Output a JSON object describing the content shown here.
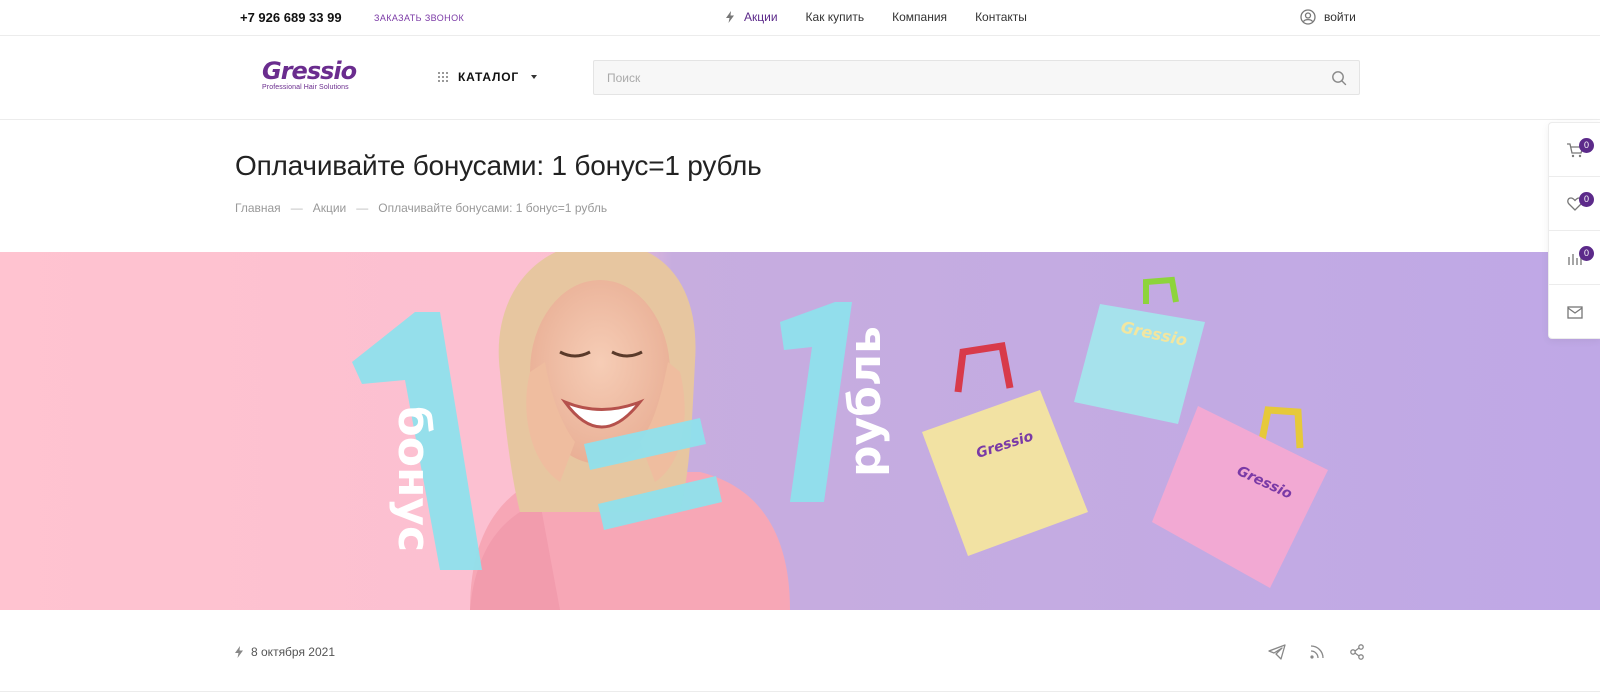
{
  "topbar": {
    "phone": "+7 926 689 33 99",
    "callback": "ЗАКАЗАТЬ ЗВОНОК",
    "nav": [
      {
        "label": "Акции"
      },
      {
        "label": "Как купить"
      },
      {
        "label": "Компания"
      },
      {
        "label": "Контакты"
      }
    ],
    "login": "войти"
  },
  "header": {
    "logo_text": "Gressio",
    "logo_tagline": "Professional Hair Solutions",
    "catalog": "КАТАЛОГ",
    "search_placeholder": "Поиск"
  },
  "page": {
    "title": "Оплачивайте бонусами: 1 бонус=1 рубль",
    "breadcrumb": [
      "Главная",
      "Акции",
      "Оплачивайте бонусами: 1 бонус=1 рубль"
    ],
    "breadcrumb_separator": "—",
    "date": "8 октября 2021"
  },
  "banner": {
    "word_left": "бонус",
    "word_right": "рубль",
    "digit": "1",
    "bag_logo": "Gressio",
    "colors": {
      "left_bg": "#ffc1cf",
      "right_bg": "#c1a9e6",
      "digit": "#8ee2ee"
    }
  },
  "sidepanel": {
    "cart_count": "0",
    "favorites_count": "0",
    "compare_count": "0"
  },
  "colors": {
    "accent": "#5c2a8a",
    "brand": "#6a2c8e"
  }
}
